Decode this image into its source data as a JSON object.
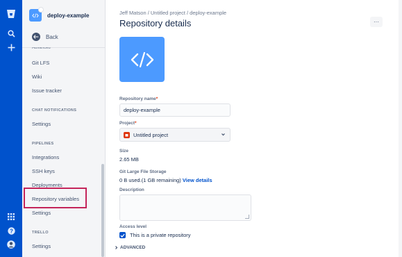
{
  "colors": {
    "nav": "#0052cc",
    "accent": "#4c9aff",
    "highlight": "#c4245a",
    "link": "#0052cc"
  },
  "global_nav": {
    "icons": [
      "bitbucket-logo-icon",
      "search-icon",
      "plus-icon",
      "apps-grid-icon",
      "help-icon",
      "user-avatar-icon"
    ]
  },
  "sidebar": {
    "repo_name": "deploy-example",
    "back_label": "Back",
    "cut_item": "Advanced",
    "items": {
      "git_lfs": "Git LFS",
      "wiki": "Wiki",
      "issue_tracker": "Issue tracker",
      "chat_settings": "Settings",
      "integrations": "Integrations",
      "ssh_keys": "SSH keys",
      "deployments": "Deployments",
      "repository_variables": "Repository variables",
      "pipelines_settings": "Settings",
      "trello_settings": "Settings"
    },
    "sections": {
      "chat": "CHAT NOTIFICATIONS",
      "pipelines": "PIPELINES",
      "trello": "TRELLO"
    }
  },
  "main": {
    "breadcrumb": "Jeff Matson  /  Untitled project  /  deploy-example",
    "title": "Repository details",
    "more_label": "···",
    "repo_name_label": "Repository name",
    "repo_name_value": "deploy-example",
    "project_label": "Project",
    "project_value": "Untitled project",
    "size_label": "Size",
    "size_value": "2.65 MB",
    "lfs_label": "Git Large File Storage",
    "lfs_value": "0 B used.(1 GB remaining)",
    "lfs_link": "View details",
    "description_label": "Description",
    "access_label": "Access level",
    "private_label": "This is a private repository",
    "advanced_label": "ADVANCED",
    "required_mark": "*"
  }
}
